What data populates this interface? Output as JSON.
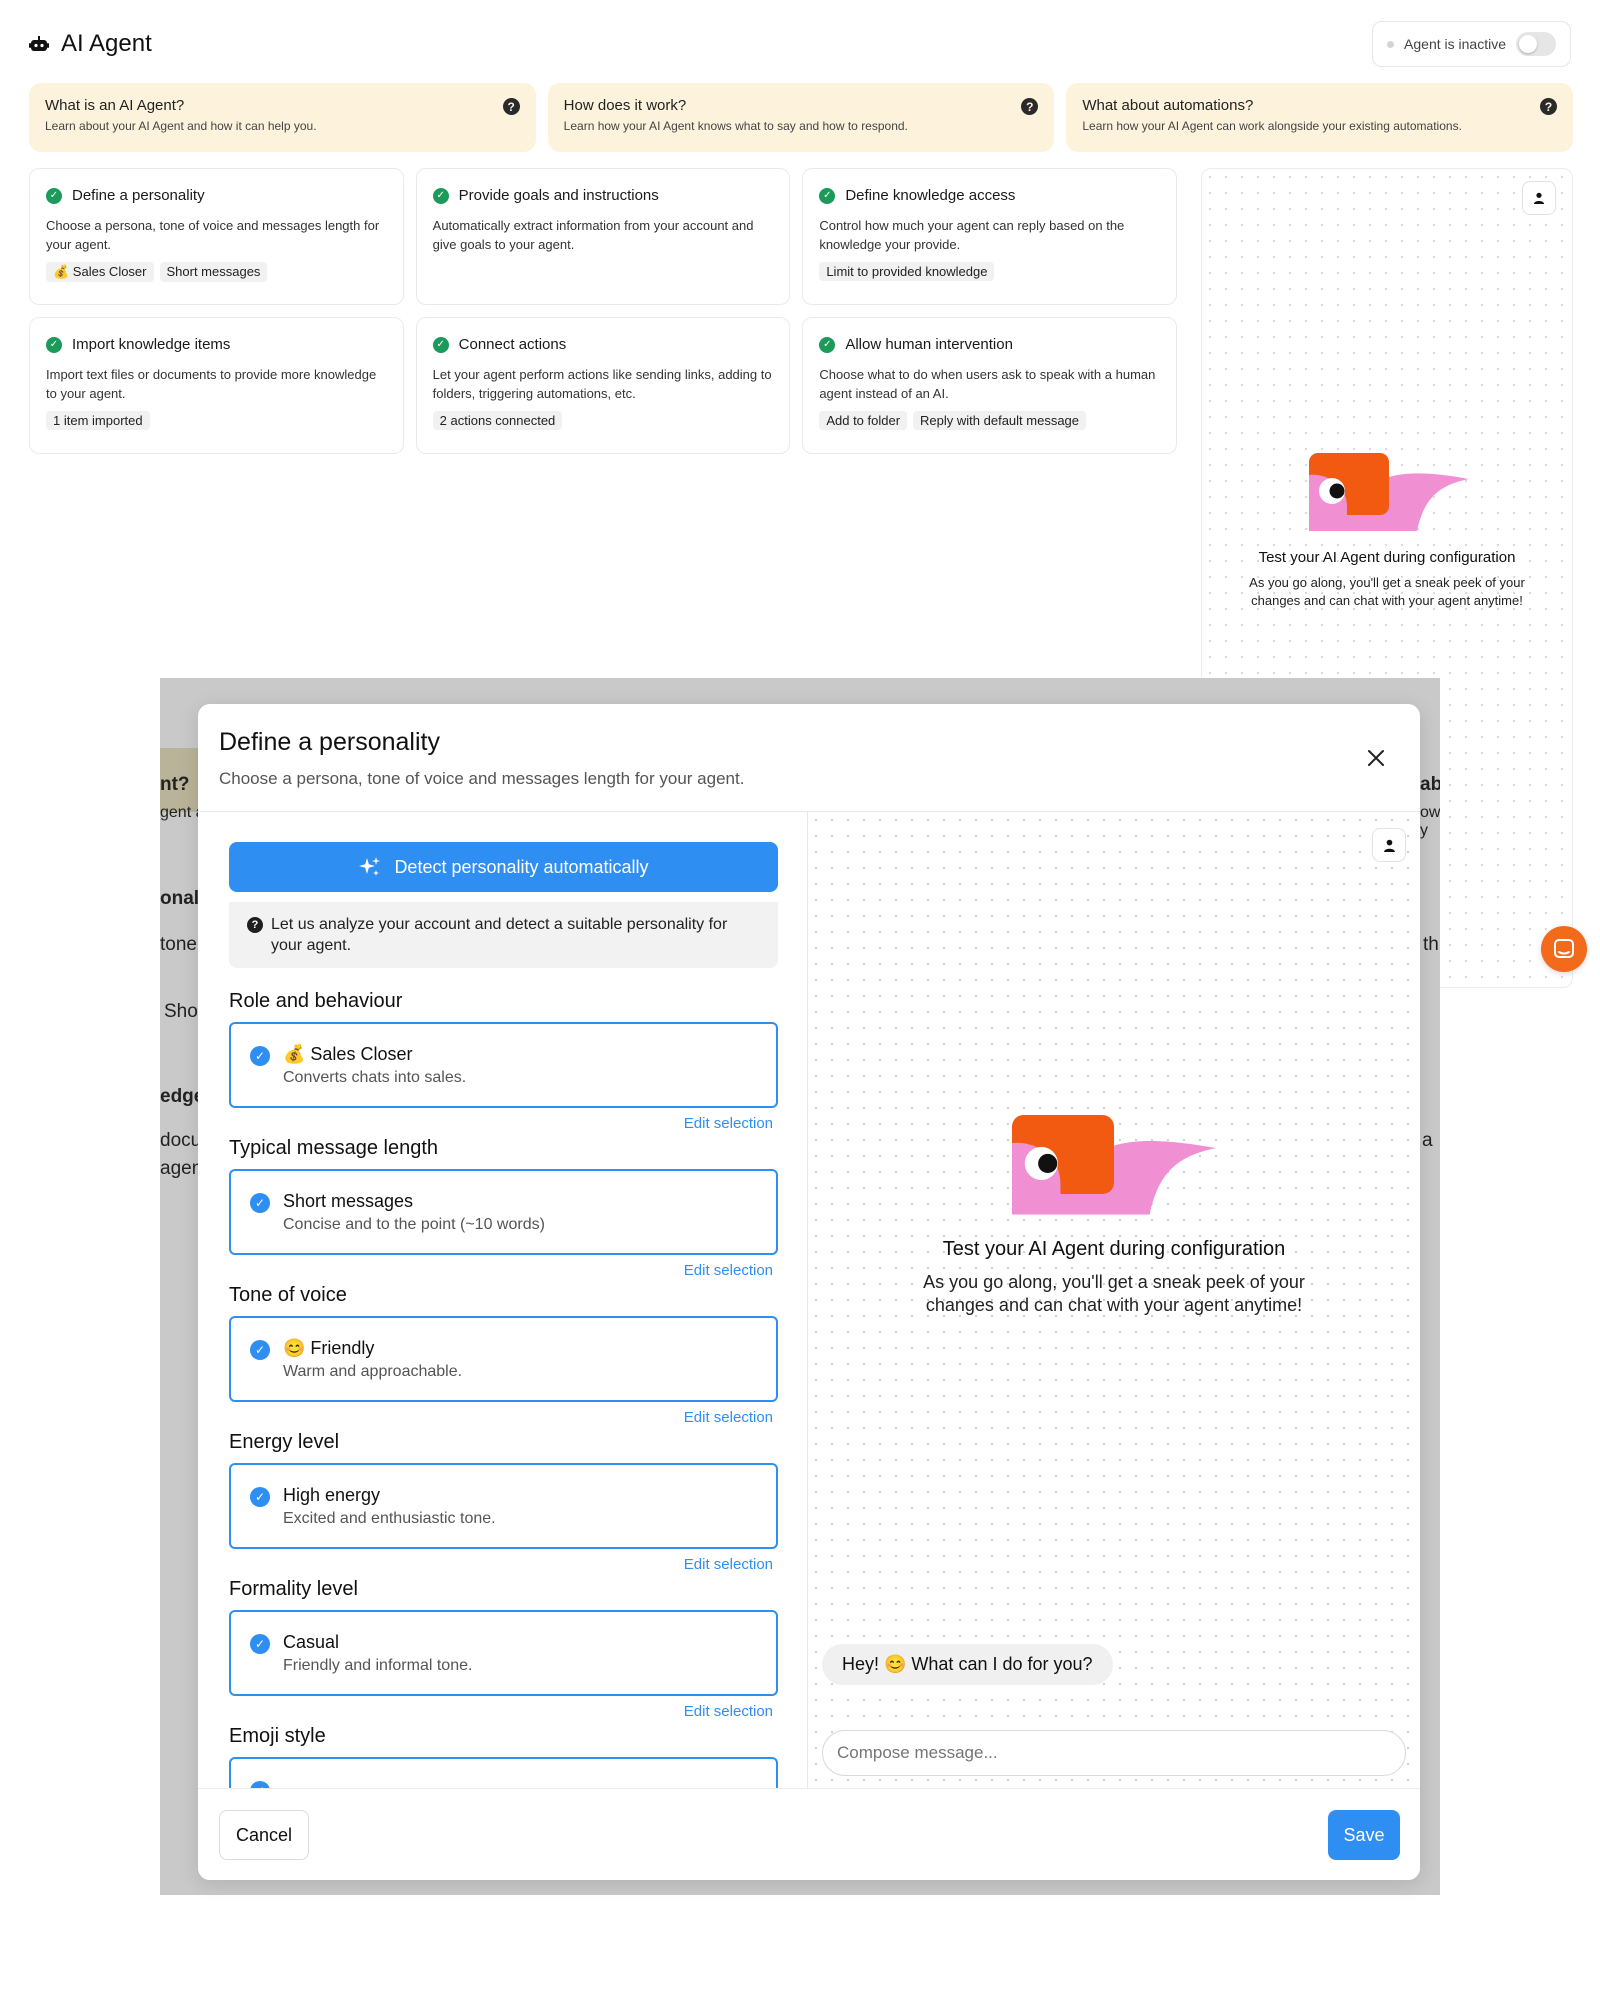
{
  "app": {
    "title": "AI Agent",
    "status_label": "Agent is inactive",
    "icon": "robot-icon"
  },
  "info_cards": [
    {
      "title": "What is an AI Agent?",
      "subtitle": "Learn about your AI Agent and how it can help you."
    },
    {
      "title": "How does it work?",
      "subtitle": "Learn how your AI Agent knows what to say and how to respond."
    },
    {
      "title": "What about automations?",
      "subtitle": "Learn how your AI Agent can work alongside your existing automations."
    }
  ],
  "steps": [
    {
      "title": "Define a personality",
      "desc": "Choose a persona, tone of voice and messages length for your agent.",
      "tags": [
        "💰 Sales Closer",
        "Short messages"
      ]
    },
    {
      "title": "Provide goals and instructions",
      "desc": "Automatically extract information from your account and give goals to your agent.",
      "tags": []
    },
    {
      "title": "Define knowledge access",
      "desc": "Control how much your agent can reply based on the knowledge your provide.",
      "tags": [
        "Limit to provided knowledge"
      ]
    },
    {
      "title": "Import knowledge items",
      "desc": "Import text files or documents to provide more knowledge to your agent.",
      "tags": [
        "1 item imported"
      ]
    },
    {
      "title": "Connect actions",
      "desc": "Let your agent perform actions like sending links, adding to folders, triggering automations, etc.",
      "tags": [
        "2 actions connected"
      ]
    },
    {
      "title": "Allow human intervention",
      "desc": "Choose what to do when users ask to speak with a human agent instead of an AI.",
      "tags": [
        "Add to folder",
        "Reply with default message"
      ]
    }
  ],
  "preview": {
    "title": "Test your AI Agent during configuration",
    "text": "As you go along, you'll get a sneak peek of your changes and can chat with your agent anytime!"
  },
  "overlay_ghost": {
    "q1": "nt?",
    "q1_sub": "gent a",
    "personal": "onal",
    "tone": "tone",
    "short": "Shor",
    "knowledge": "edge",
    "docs": "docu",
    "agent": "agent",
    "q3": "abo",
    "q3_sub": "ow y",
    "the": "th",
    "a": "a"
  },
  "modal": {
    "title": "Define a personality",
    "subtitle": "Choose a persona, tone of voice and messages length for your agent.",
    "detect_label": "Detect personality automatically",
    "detect_note": "Let us analyze your account and detect a suitable personality for your agent.",
    "edit_label": "Edit selection",
    "sections": [
      {
        "title": "Role and behaviour",
        "name": "💰 Sales Closer",
        "sub": "Converts chats into sales."
      },
      {
        "title": "Typical message length",
        "name": "Short messages",
        "sub": "Concise and to the point (~10 words)"
      },
      {
        "title": "Tone of voice",
        "name": "😊 Friendly",
        "sub": "Warm and approachable."
      },
      {
        "title": "Energy level",
        "name": "High energy",
        "sub": "Excited and enthusiastic tone."
      },
      {
        "title": "Formality level",
        "name": "Casual",
        "sub": "Friendly and informal tone."
      },
      {
        "title": "Emoji style",
        "name": "",
        "sub": ""
      }
    ],
    "chat_bubble": "Hey! 😊 What can I do for you?",
    "compose_placeholder": "Compose message...",
    "cancel_label": "Cancel",
    "save_label": "Save"
  },
  "colors": {
    "accent": "#2f8ef2",
    "success": "#1b9a5a",
    "info_bg": "#fdf3dc",
    "mascot_orange": "#f25a12",
    "mascot_pink": "#f08fd2",
    "fab": "#f36a1a"
  }
}
